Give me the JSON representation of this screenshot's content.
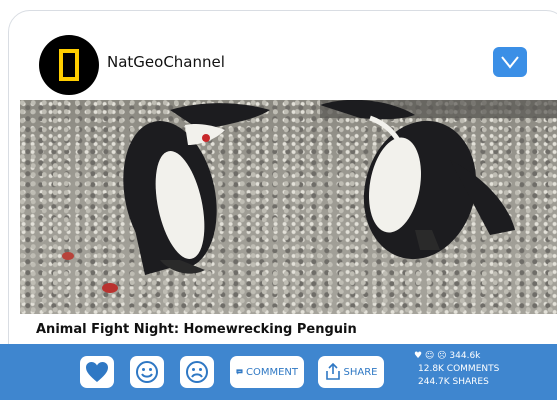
{
  "post": {
    "channel_name": "NatGeoChannel",
    "caption": "Animal Fight Night: Homewrecking Penguin"
  },
  "icons": {
    "avatar": "natgeo-yellow-frame-icon",
    "menu": "chevron-down-icon",
    "like": "heart-icon",
    "happy": "smiley-icon",
    "sad": "frown-icon",
    "comment": "speech-bubble-icon",
    "share": "share-arrow-icon"
  },
  "actions": {
    "comment_label": "COMMENT",
    "share_label": "SHARE"
  },
  "stats": {
    "reactions": "344.6k",
    "comments": "12.8K COMMENTS",
    "shares": "244.7K SHARES"
  },
  "colors": {
    "accent": "#3f86cf",
    "button_blue": "#3b8fe6",
    "brand_yellow": "#ffce00"
  }
}
